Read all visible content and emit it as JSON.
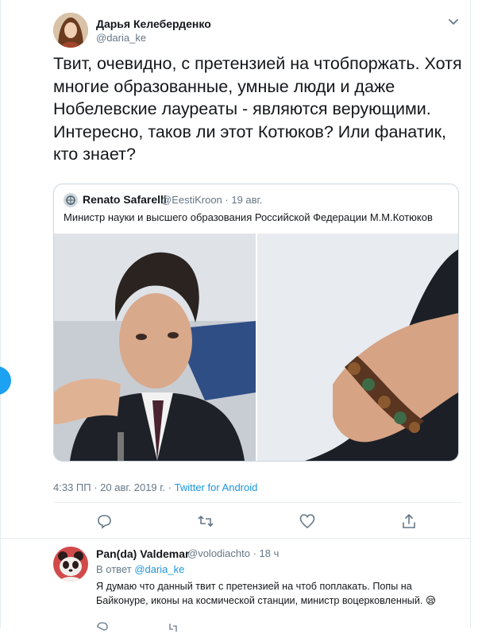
{
  "tweet": {
    "author_name": "Дарья Келеберденко",
    "author_handle": "@daria_ke",
    "text": "Твит, очевидно, с претензией на чтобпоржать. Хотя многие образованные, умные люди и даже Нобелевские лауреаты - являются верующими. Интересно, таков ли этот Котюков? Или фанатик, кто знает?",
    "time": "4:33 ПП · 20 авг. 2019 г. · ",
    "source": "Twitter for Android",
    "actions": [
      "reply-icon",
      "retweet-icon",
      "like-icon",
      "share-icon"
    ]
  },
  "quote": {
    "author_name": "Renato Safarelli",
    "author_handle": "@EestiKroon · 19 авг.",
    "text": "Министр науки и высшего образования Российской Федерации М.М.Котюков"
  },
  "reply": {
    "author_name": "Pan(da) Valdemar",
    "author_handle": "@volodiachto · 18 ч",
    "reply_to_prefix": "В ответ ",
    "reply_to_mention": "@daria_ke",
    "text": "Я думаю что данный твит с претензией на чтоб поплакать. Попы на Байконуре, иконы на космической станции, министр воцерковленный. 😪"
  },
  "colors": {
    "accent": "#1da1f2",
    "link": "#1b95e0",
    "muted": "#657786",
    "border": "#e6ecf0"
  }
}
